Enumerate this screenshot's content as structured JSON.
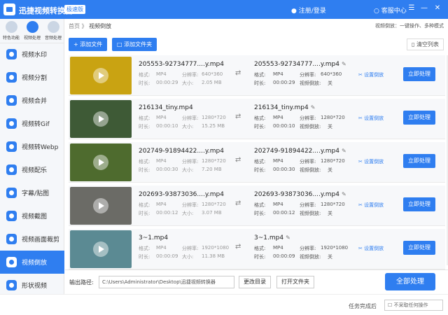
{
  "app": {
    "title": "迅捷视频转换器",
    "badge": "极速版",
    "login": "注册/登录",
    "service": "客服中心"
  },
  "sidebar": {
    "top_tabs": [
      {
        "label": "特色功能"
      },
      {
        "label": "视频处理"
      },
      {
        "label": "音频处理"
      }
    ],
    "items": [
      {
        "label": "视频水印"
      },
      {
        "label": "视频分割"
      },
      {
        "label": "视频合并"
      },
      {
        "label": "视频转Gif"
      },
      {
        "label": "视频转Webp"
      },
      {
        "label": "视频配乐"
      },
      {
        "label": "字幕/贴图"
      },
      {
        "label": "视频截图"
      },
      {
        "label": "视频画面裁剪"
      },
      {
        "label": "视频倒放"
      },
      {
        "label": "形状视频"
      }
    ],
    "active_index": 9
  },
  "breadcrumb": {
    "home": "首页",
    "sep": "》",
    "current": "视频倒放"
  },
  "mode_info": "视频倒放：一键操作、多种模式",
  "toolbar": {
    "add_file": "+ 添加文件",
    "add_folder": "添加文件夹",
    "clear_list": "清空列表"
  },
  "labels": {
    "format": "格式:",
    "duration": "时长:",
    "resolution": "分辨率:",
    "size": "大小:",
    "reverse": "视频倒放:",
    "set_reverse": "设置倒放",
    "process": "立即处理"
  },
  "files": [
    {
      "in_name": "205553-92734777....y.mp4",
      "format": "MP4",
      "resolution": "640*360",
      "duration": "00:00:29",
      "size": "2.05 MB",
      "out_name": "205553-92734777....y.mp4",
      "out_format": "MP4",
      "out_resolution": "640*360",
      "out_duration": "00:00:29",
      "reverse": "关"
    },
    {
      "in_name": "216134_tiny.mp4",
      "format": "MP4",
      "resolution": "1280*720",
      "duration": "00:00:10",
      "size": "15.25 MB",
      "out_name": "216134_tiny.mp4",
      "out_format": "MP4",
      "out_resolution": "1280*720",
      "out_duration": "00:00:10",
      "reverse": "关"
    },
    {
      "in_name": "202749-91894422....y.mp4",
      "format": "MP4",
      "resolution": "1280*720",
      "duration": "00:00:30",
      "size": "7.20 MB",
      "out_name": "202749-91894422....y.mp4",
      "out_format": "MP4",
      "out_resolution": "1280*720",
      "out_duration": "00:00:30",
      "reverse": "关"
    },
    {
      "in_name": "202693-93873036....y.mp4",
      "format": "MP4",
      "resolution": "1280*720",
      "duration": "00:00:12",
      "size": "3.07 MB",
      "out_name": "202693-93873036....y.mp4",
      "out_format": "MP4",
      "out_resolution": "1280*720",
      "out_duration": "00:00:12",
      "reverse": "关"
    },
    {
      "in_name": "3~1.mp4",
      "format": "MP4",
      "resolution": "1920*1080",
      "duration": "00:00:09",
      "size": "11.38 MB",
      "out_name": "3~1.mp4",
      "out_format": "MP4",
      "out_resolution": "1920*1080",
      "out_duration": "00:00:09",
      "reverse": "关"
    }
  ],
  "thumb_colors": [
    "#c9a312",
    "#3e5a36",
    "#4e6b2e",
    "#6b6b66",
    "#5b8a93"
  ],
  "output": {
    "label": "输出路径:",
    "path": "C:\\Users\\Administrator\\Desktop\\迅捷视频转换器",
    "change_dir": "更改目录",
    "open_folder": "打开文件夹",
    "process_all": "全部处理"
  },
  "status": {
    "after_label": "任务完成后",
    "after_value": "不采取任何操作"
  }
}
